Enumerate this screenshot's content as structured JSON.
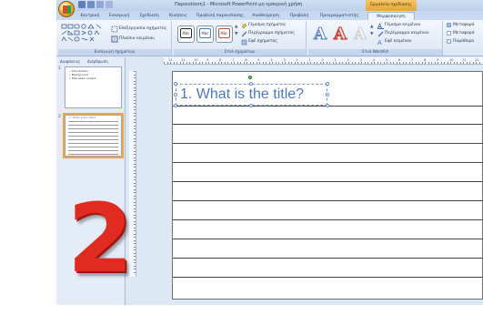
{
  "window": {
    "title": "Παρουσίαση1 - Microsoft PowerPoint μη εμπορική χρήση",
    "context_tab_group": "Εργαλεία σχεδίασης"
  },
  "tabs": [
    {
      "label": "Κεντρική"
    },
    {
      "label": "Εισαγωγή"
    },
    {
      "label": "Σχεδίαση"
    },
    {
      "label": "Κινήσεις"
    },
    {
      "label": "Προβολή παρουσίασης"
    },
    {
      "label": "Αναθεώρηση"
    },
    {
      "label": "Προβολή"
    },
    {
      "label": "Προγραμματιστής"
    },
    {
      "label": "Μορφοποίηση",
      "active": true
    }
  ],
  "ribbon": {
    "insert_shapes": {
      "edit_shape": "Επεξεργασία σχήματος",
      "text_box": "Πλαίσιο κειμένου",
      "label": "Εισαγωγή σχημάτων"
    },
    "shape_styles": {
      "style_label": "Abc",
      "fill": "Γέμισμα σχήματος",
      "outline": "Περίγραμμα σχήματος",
      "effects": "Εφέ σχήματος",
      "label": "Στυλ σχημάτων"
    },
    "wordart": {
      "letter": "A",
      "text_fill": "Γέμισμα κειμένου",
      "text_outline": "Περίγραμμα κειμένου",
      "text_effects": "Εφέ κειμένου",
      "label": "Στυλ WordArt"
    },
    "arrange": {
      "bring_front": "Μεταφορά",
      "send_back": "Μεταφορά",
      "selection_pane": "Παράθυρο"
    }
  },
  "slides_pane": {
    "tab_slides": "Διαφάνειες",
    "tab_outline": "Διάρθρωση",
    "slides": [
      {
        "number": "1",
        "lines": [
          "• Introduction",
          "• Background",
          "• Title slide content"
        ]
      },
      {
        "number": "2",
        "lines": [
          "1. What is the title?"
        ]
      }
    ]
  },
  "ruler": {
    "numbers": [
      "12",
      "11",
      "10",
      "9",
      "8",
      "7",
      "6",
      "5",
      "4",
      "3",
      "2",
      "1",
      "0",
      "1",
      "2",
      "3",
      "4",
      "5",
      "6",
      "7",
      "8",
      "9",
      "10",
      "11",
      "12"
    ]
  },
  "slide": {
    "title": "1. What is the title?"
  },
  "overlay": {
    "step_number": "2",
    "color": "#e12a20"
  }
}
